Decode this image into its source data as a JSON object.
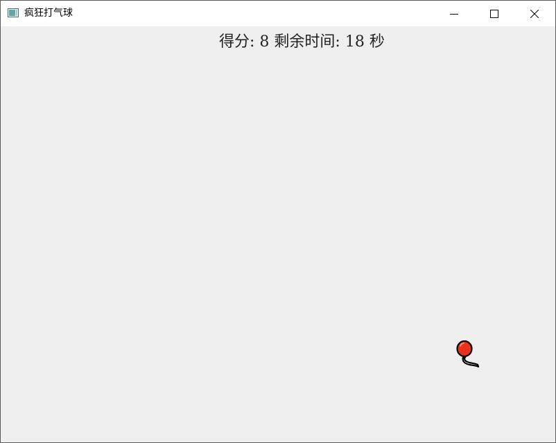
{
  "window": {
    "title": "疯狂打气球",
    "icon": "app-window-icon",
    "controls": {
      "minimize": "minimize-icon",
      "maximize": "maximize-icon",
      "close": "close-icon"
    }
  },
  "hud": {
    "score_label": "得分:",
    "score": "8",
    "time_label": "剩余时间:",
    "time_remaining": "18",
    "time_unit": "秒"
  },
  "game": {
    "balloons": [
      {
        "color": "#e8321e",
        "icon": "balloon-icon"
      }
    ]
  },
  "colors": {
    "background": "#efefef",
    "titlebar": "#ffffff",
    "balloon": "#e8321e"
  }
}
